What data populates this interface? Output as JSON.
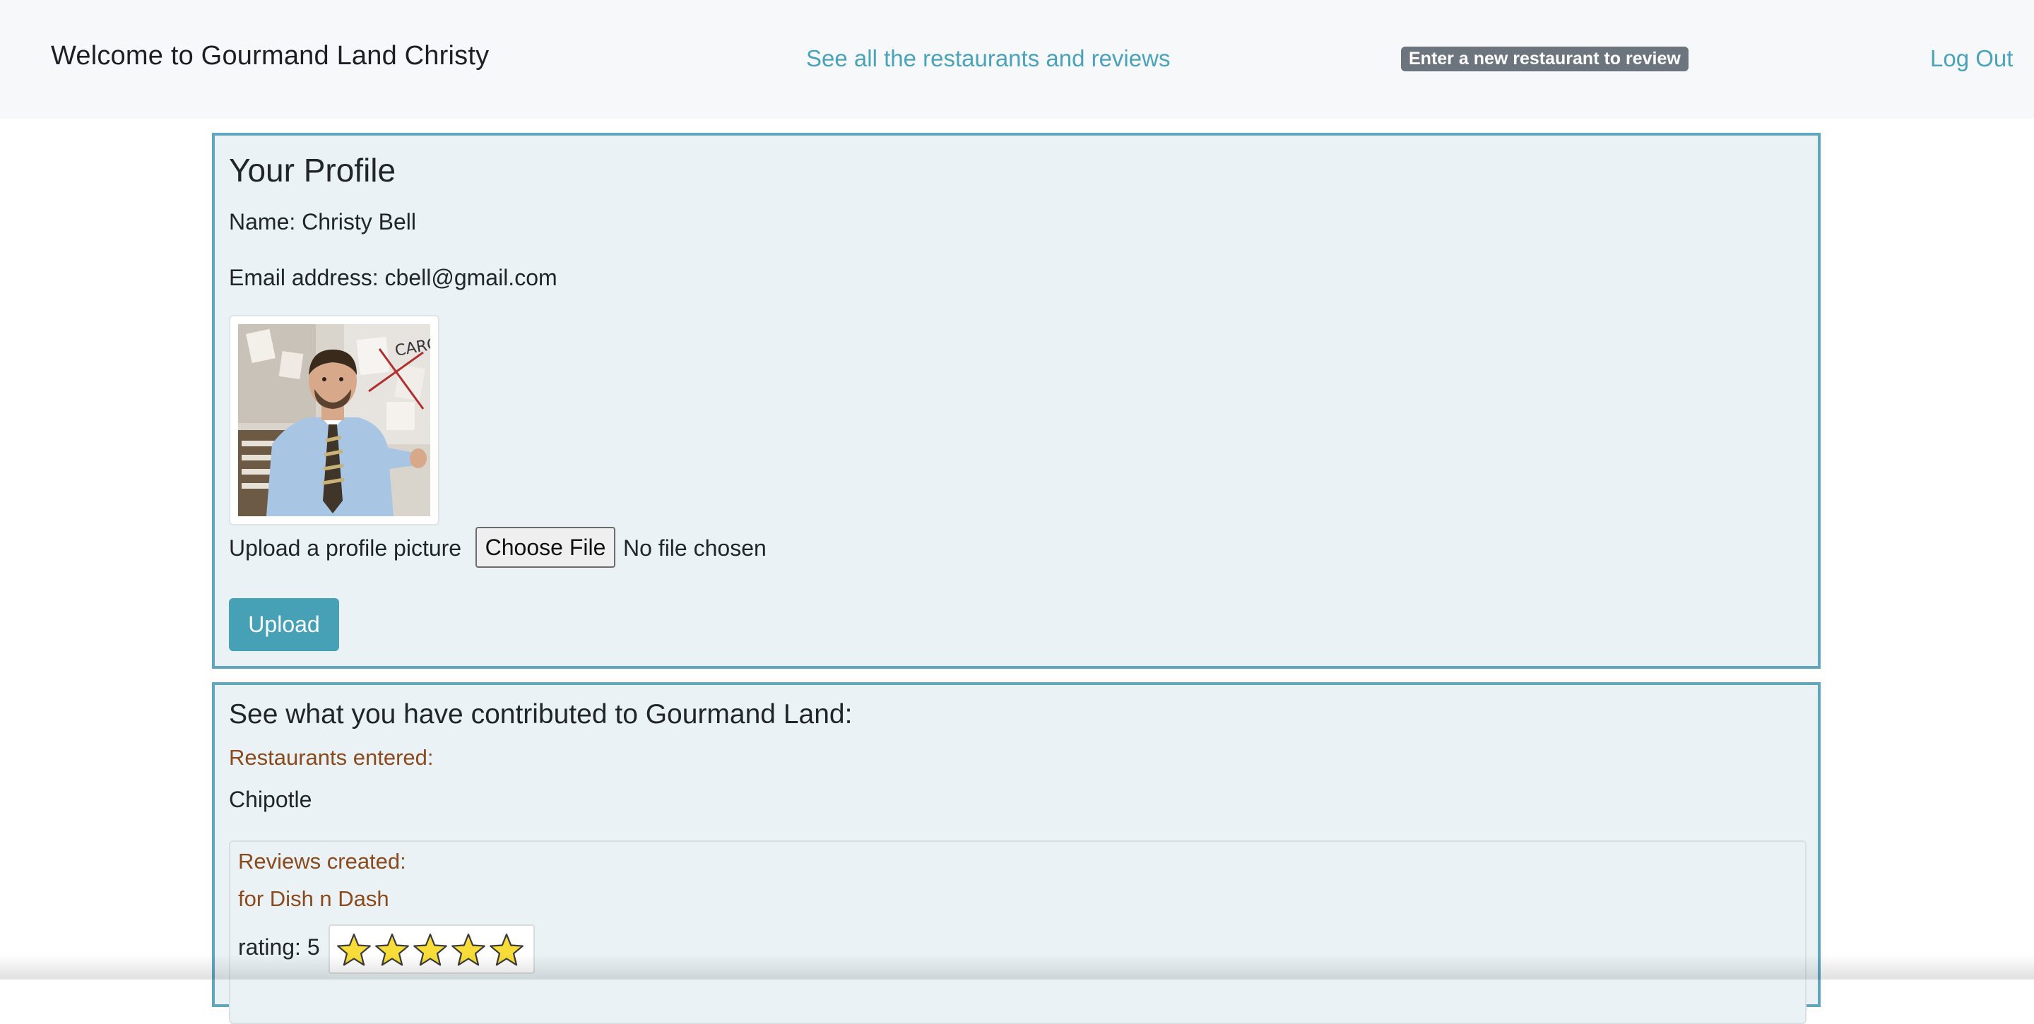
{
  "navbar": {
    "brand": "Welcome to Gourmand Land Christy",
    "all_restaurants_link": "See all the restaurants and reviews",
    "new_restaurant_badge": "Enter a new restaurant to review",
    "logout_link": "Log Out"
  },
  "profile": {
    "heading": "Your Profile",
    "name_line": "Name: Christy Bell",
    "email_line": "Email address: cbell@gmail.com",
    "upload_label": "Upload a profile picture",
    "choose_file_label": "Choose File",
    "no_file_text": "No file chosen",
    "upload_button": "Upload",
    "avatar_sign_text": "CARO"
  },
  "contributions": {
    "heading": "See what you have contributed to Gourmand Land:",
    "restaurants_heading": "Restaurants entered:",
    "restaurants": [
      "Chipotle"
    ],
    "reviews_heading": "Reviews created:",
    "review": {
      "for_line": "for Dish n Dash",
      "rating_label": "rating: 5",
      "stars": 5
    }
  },
  "colors": {
    "link": "#4aa3b8",
    "card_border": "#5fa6be",
    "card_bg": "#eaf2f6",
    "accent_brown": "#8a4a1c",
    "button": "#46a1b6",
    "badge": "#6c757d",
    "star_fill": "#f7dc3a"
  }
}
